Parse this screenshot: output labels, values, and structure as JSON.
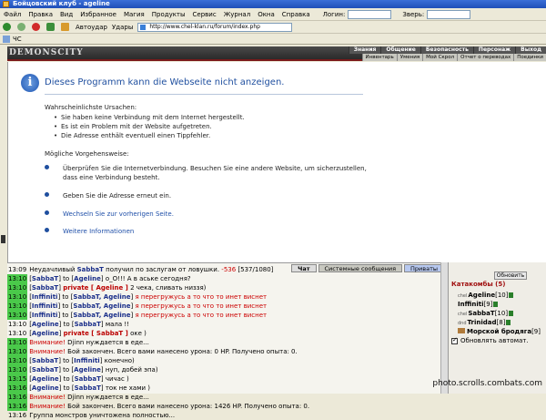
{
  "window": {
    "title": "Бойцовский клуб - ageline"
  },
  "menu": {
    "items": [
      "Файл",
      "Правка",
      "Вид",
      "Избранное",
      "Магия",
      "Продукты",
      "Сервис",
      "Журнал",
      "Окна",
      "Справка"
    ],
    "login_label": "Логин:",
    "beast_label": "Зверь:"
  },
  "toolbar": {
    "autopilot": "Автоудар",
    "ydar": "Удары",
    "address": "http://www.chel-klan.ru/forum/index.php"
  },
  "tab": {
    "label": "ЧС"
  },
  "game": {
    "logo": "DEMONSCITY",
    "nav": [
      "Знания",
      "Общение",
      "Безопасность",
      "Персонаж",
      "Выход"
    ],
    "subnav": [
      "Инвентарь",
      "Умения",
      "Мой Скрол",
      "Отчет о переводах",
      "Поединки"
    ]
  },
  "error": {
    "title": "Dieses Programm kann die Webseite nicht anzeigen.",
    "causes_title": "Wahrscheinlichste Ursachen:",
    "causes": [
      "Sie haben keine Verbindung mit dem Internet hergestellt.",
      "Es ist ein Problem mit der Website aufgetreten.",
      "Die Adresse enthält eventuell einen Tippfehler."
    ],
    "steps_title": "Mögliche Vorgehensweise:",
    "step1": "Überprüfen Sie die Internetverbindung. Besuchen Sie eine andere Website, um sicherzustellen, dass eine Verbindung besteht.",
    "step2": "Geben Sie die Adresse erneut ein.",
    "step3": "Wechseln Sie zur vorherigen Seite.",
    "step4": "Weitere Informationen"
  },
  "chat": {
    "tabs": [
      "Чат",
      "Системные сообщения",
      "Приваты"
    ],
    "lines": [
      {
        "t": "13:09",
        "g": false,
        "parts": [
          [
            "",
            "Неудачливый "
          ],
          [
            "nm",
            "SabbaT"
          ],
          [
            "",
            " получил по заслугам от ловушки. "
          ],
          [
            "red",
            "-536"
          ],
          [
            "",
            " [537/1080]"
          ]
        ]
      },
      {
        "t": "13:10",
        "g": true,
        "parts": [
          [
            "",
            "["
          ],
          [
            "nm",
            "SabbaT"
          ],
          [
            "",
            "] to ["
          ],
          [
            "nm",
            "Ageline"
          ],
          [
            "",
            "] o_O!!! А в аське сегодня?"
          ]
        ]
      },
      {
        "t": "13:10",
        "g": true,
        "parts": [
          [
            "",
            "["
          ],
          [
            "nm",
            "SabbaT"
          ],
          [
            "",
            "] "
          ],
          [
            "priv",
            "private [ Ageline ]"
          ],
          [
            "",
            " 2 чека, сливать низзя)"
          ]
        ]
      },
      {
        "t": "13:10",
        "g": true,
        "parts": [
          [
            "",
            "["
          ],
          [
            "nm",
            "Inffiniti"
          ],
          [
            "",
            "] to ["
          ],
          [
            "nm",
            "SabbaT, Ageline"
          ],
          [
            "",
            "] "
          ],
          [
            "pink",
            "я перегружусь а то что то инет виснет"
          ]
        ]
      },
      {
        "t": "13:10",
        "g": true,
        "parts": [
          [
            "",
            "["
          ],
          [
            "nm",
            "Inffiniti"
          ],
          [
            "",
            "] to ["
          ],
          [
            "nm",
            "SabbaT, Ageline"
          ],
          [
            "",
            "] "
          ],
          [
            "pink",
            "я перегружусь а то что то инет виснет"
          ]
        ]
      },
      {
        "t": "13:10",
        "g": true,
        "parts": [
          [
            "",
            "["
          ],
          [
            "nm",
            "Inffiniti"
          ],
          [
            "",
            "] to ["
          ],
          [
            "nm",
            "SabbaT, Ageline"
          ],
          [
            "",
            "] "
          ],
          [
            "pink",
            "я перегружусь а то что то инет виснет"
          ]
        ]
      },
      {
        "t": "13:10",
        "g": false,
        "parts": [
          [
            "",
            "["
          ],
          [
            "nm",
            "Ageline"
          ],
          [
            "",
            "] to ["
          ],
          [
            "nm",
            "SabbaT"
          ],
          [
            "",
            "] мала !!"
          ]
        ]
      },
      {
        "t": "13:10",
        "g": false,
        "parts": [
          [
            "",
            "["
          ],
          [
            "nm",
            "Ageline"
          ],
          [
            "",
            "] "
          ],
          [
            "priv",
            "private [ SabbaT ]"
          ],
          [
            "",
            " оке )"
          ]
        ]
      },
      {
        "t": "13:10",
        "g": true,
        "parts": [
          [
            "red",
            "Внимание!"
          ],
          [
            "",
            " Djinn нуждается в еде..."
          ]
        ]
      },
      {
        "t": "13:10",
        "g": true,
        "parts": [
          [
            "red",
            "Внимание!"
          ],
          [
            "",
            " Бой закончен. Всего вами нанесено урона: 0 HP. Получено опыта: 0."
          ]
        ]
      },
      {
        "t": "13:10",
        "g": true,
        "parts": [
          [
            "",
            "["
          ],
          [
            "nm",
            "SabbaT"
          ],
          [
            "",
            "] to ["
          ],
          [
            "nm",
            "Inffiniti"
          ],
          [
            "",
            "] конечно)"
          ]
        ]
      },
      {
        "t": "13:10",
        "g": true,
        "parts": [
          [
            "",
            "["
          ],
          [
            "nm",
            "SabbaT"
          ],
          [
            "",
            "] to ["
          ],
          [
            "nm",
            "Ageline"
          ],
          [
            "",
            "] нуп, добей эпа)"
          ]
        ]
      },
      {
        "t": "13:15",
        "g": true,
        "parts": [
          [
            "",
            "["
          ],
          [
            "nm",
            "Ageline"
          ],
          [
            "",
            "] to ["
          ],
          [
            "nm",
            "SabbaT"
          ],
          [
            "",
            "] чичас )"
          ]
        ]
      },
      {
        "t": "13:16",
        "g": true,
        "parts": [
          [
            "",
            "["
          ],
          [
            "nm",
            "Ageline"
          ],
          [
            "",
            "] to ["
          ],
          [
            "nm",
            "SabbaT"
          ],
          [
            "",
            "] ток не хами )"
          ]
        ]
      },
      {
        "t": "13:16",
        "g": true,
        "parts": [
          [
            "red",
            "Внимание!"
          ],
          [
            "",
            " Djinn нуждается в еде..."
          ]
        ]
      },
      {
        "t": "13:16",
        "g": true,
        "parts": [
          [
            "red",
            "Внимание!"
          ],
          [
            "",
            " Бой закончен. Всего вами нанесено урона: 1426 HP. Получено опыта: 0."
          ]
        ]
      },
      {
        "t": "13:16",
        "g": false,
        "parts": [
          [
            "",
            "Группа монстров уничтожена полностью..."
          ]
        ]
      }
    ]
  },
  "sidebar": {
    "refresh": "Обновить",
    "location": "Катакомбы (5)",
    "players": [
      {
        "clan": "chel",
        "name": "Ageline",
        "level": "[10]",
        "flag": true
      },
      {
        "clan": "",
        "name": "Inffiniti",
        "level": "[9]",
        "flag": true
      },
      {
        "clan": "chel",
        "name": "SabbaT",
        "level": "[10]",
        "flag": true
      },
      {
        "clan": "dnd",
        "name": "Trinidad",
        "level": "[8]",
        "flag": true
      },
      {
        "clan": "",
        "name": "Морской бродяга",
        "level": "[9]",
        "flag": false,
        "monster": true
      }
    ],
    "auto_refresh": "Обновлять автомат."
  },
  "watermark": "photo.scrolls.combats.com"
}
